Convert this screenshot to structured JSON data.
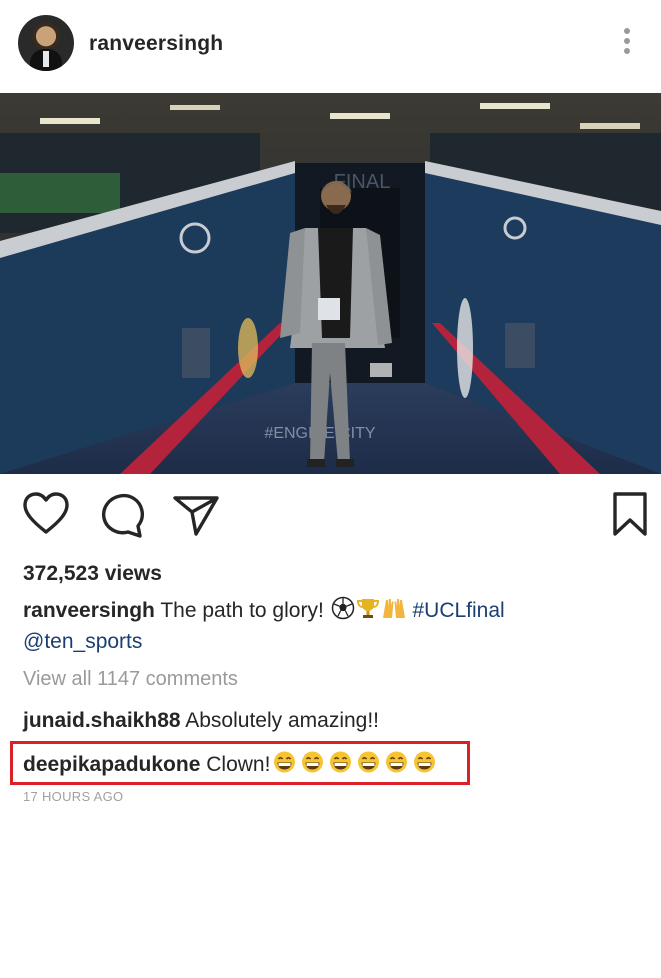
{
  "post": {
    "username": "ranveersingh",
    "views": "372,523 views",
    "caption": {
      "username": "ranveersingh",
      "text": "The path to glory!",
      "emojis": [
        "soccer-ball",
        "trophy",
        "raised-hands"
      ],
      "hashtag": "#UCLfinal",
      "mention": "@ten_sports"
    },
    "view_all_comments": "View all 1147 comments",
    "comments": [
      {
        "username": "junaid.shaikh88",
        "text": "Absolutely amazing!!",
        "emojis": []
      },
      {
        "username": "deepikapadukone",
        "text": "Clown!",
        "emojis": [
          "grinning-face",
          "grinning-face",
          "grinning-face",
          "grinning-face",
          "grinning-face",
          "grinning-face"
        ]
      }
    ],
    "timestamp": "17 HOURS AGO",
    "media": {
      "banner_text": "FINAL",
      "floor_text": "#ENGINE CITY"
    }
  },
  "icons": {
    "more": "more-vertical-icon",
    "like": "heart-icon",
    "comment": "comment-bubble-icon",
    "share": "paper-plane-icon",
    "save": "bookmark-icon"
  },
  "colors": {
    "text": "#262626",
    "muted": "#9a9a9a",
    "link": "#1b3f72",
    "highlight": "#d92127"
  }
}
